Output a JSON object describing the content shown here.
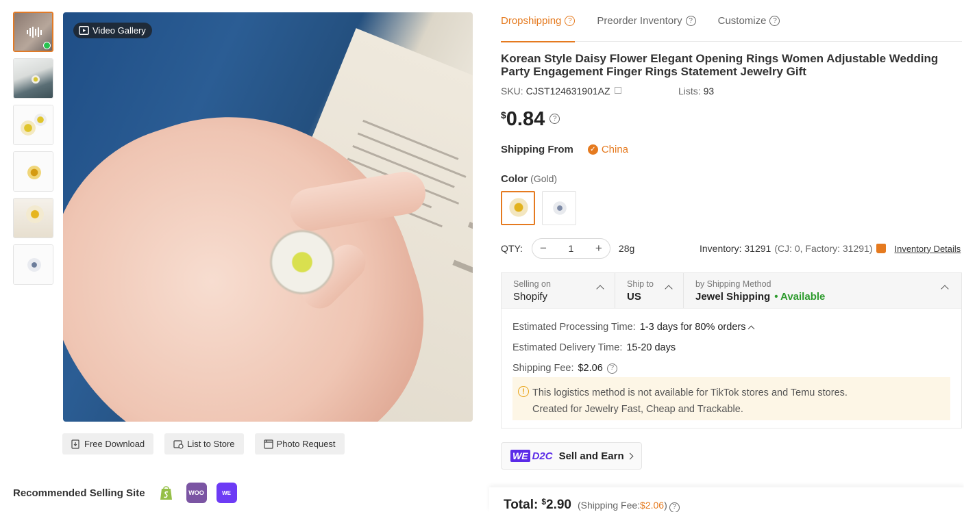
{
  "gallery": {
    "video_label": "Video Gallery",
    "thumbnail_count": 6
  },
  "actions": {
    "free_download": "Free Download",
    "list_to_store": "List to Store",
    "photo_request": "Photo Request"
  },
  "recommended": {
    "label": "Recommended Selling Site",
    "sites": [
      "shopify-icon",
      "woocommerce-icon",
      "wed2c-icon"
    ]
  },
  "tabs": [
    {
      "label": "Dropshipping",
      "active": true
    },
    {
      "label": "Preorder Inventory",
      "active": false
    },
    {
      "label": "Customize",
      "active": false
    }
  ],
  "product": {
    "title": "Korean Style Daisy Flower Elegant Opening Rings Women Adjustable Wedding Party Engagement Finger Rings Statement Jewelry Gift",
    "sku_label": "SKU:",
    "sku": "CJST124631901AZ",
    "lists_label": "Lists:",
    "lists": "93",
    "price_currency": "$",
    "price": "0.84"
  },
  "shipping_from": {
    "label": "Shipping From",
    "country": "China"
  },
  "color": {
    "label": "Color",
    "selected": "(Gold)",
    "options": [
      "Gold",
      "Silver"
    ]
  },
  "quantity": {
    "label": "QTY:",
    "value": "1",
    "minus": "−",
    "plus": "+",
    "weight": "28g",
    "inventory_label": "Inventory:",
    "inventory": "31291",
    "inventory_detail": "(CJ: 0, Factory: 31291)",
    "inventory_link": "Inventory Details"
  },
  "shipping": {
    "selling_on_label": "Selling on",
    "selling_on": "Shopify",
    "ship_to_label": "Ship to",
    "ship_to": "US",
    "method_label": "by Shipping Method",
    "method": "Jewel Shipping",
    "status": "• Available",
    "processing_label": "Estimated Processing Time:",
    "processing": "1-3 days for 80% orders",
    "delivery_label": "Estimated Delivery Time:",
    "delivery": "15-20 days",
    "fee_label": "Shipping Fee:",
    "fee": "$2.06",
    "notice_line1": "This logistics method is not available for TikTok stores and Temu stores.",
    "notice_line2": "Created for Jewelry Fast, Cheap and Trackable."
  },
  "d2c": {
    "we": "WE",
    "d2c": "D2C",
    "label": "Sell and Earn"
  },
  "total": {
    "label": "Total:",
    "currency": "$",
    "amount": "2.90",
    "fee_prefix": "(Shipping Fee: ",
    "fee": "$2.06",
    "fee_suffix": ")"
  },
  "colors": {
    "accent": "#e57a1f",
    "available": "#2d9b2d",
    "d2c": "#5b2be8"
  }
}
